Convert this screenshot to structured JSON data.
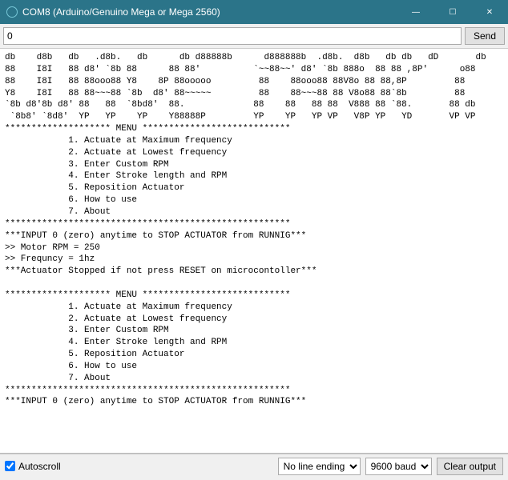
{
  "titlebar": {
    "title": "COM8 (Arduino/Genuino Mega or Mega 2560)"
  },
  "input": {
    "value": "0",
    "send_label": "Send"
  },
  "console": {
    "text": "db    d8b   db   .d8b.   db      db d88888b      d888888b  .d8b.  d8b   db db   dD       db\n88    I8I   88 d8' `8b 88      88 88'          `~~88~~' d8' `8b 888o  88 88 ,8P'      o88\n88    I8I   88 88ooo88 Y8    8P 88ooooo         88    88ooo88 88V8o 88 88,8P         88\nY8    I8I   88 88~~~88 `8b  d8' 88~~~~~         88    88~~~88 88 V8o88 88`8b         88\n`8b d8'8b d8' 88   88  `8bd8'  88.             88    88   88 88  V888 88 `88.       88 db\n `8b8' `8d8'  YP   YP    YP    Y88888P         YP    YP   YP VP   V8P YP   YD       VP VP\n******************** MENU ****************************\n            1. Actuate at Maximum frequency\n            2. Actuate at Lowest frequency\n            3. Enter Custom RPM\n            4. Enter Stroke length and RPM\n            5. Reposition Actuator\n            6. How to use\n            7. About\n******************************************************\n***INPUT 0 (zero) anytime to STOP ACTUATOR from RUNNIG***\n>> Motor RPM = 250\n>> Frequncy = 1hz\n***Actuator Stopped if not press RESET on microcontoller***\n\n******************** MENU ****************************\n            1. Actuate at Maximum frequency\n            2. Actuate at Lowest frequency\n            3. Enter Custom RPM\n            4. Enter Stroke length and RPM\n            5. Reposition Actuator\n            6. How to use\n            7. About\n******************************************************\n***INPUT 0 (zero) anytime to STOP ACTUATOR from RUNNIG***\n"
  },
  "bottom": {
    "autoscroll_label": "Autoscroll",
    "line_ending_selected": "No line ending",
    "baud_selected": "9600 baud",
    "clear_label": "Clear output"
  }
}
